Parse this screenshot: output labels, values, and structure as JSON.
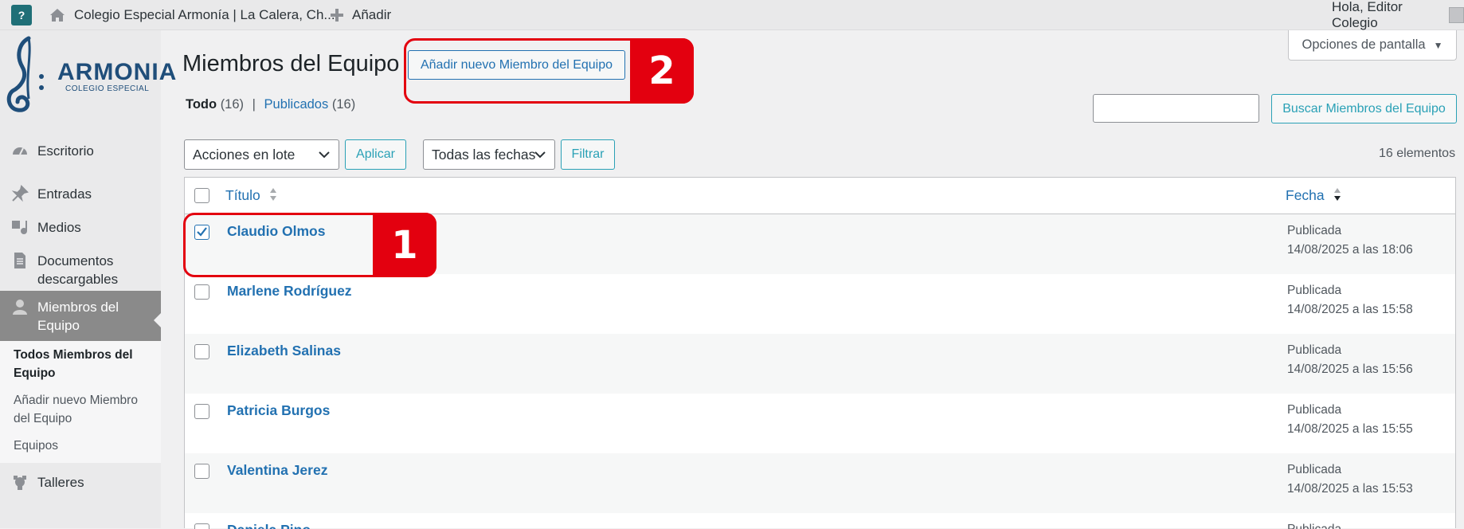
{
  "adminbar": {
    "site_name": "Colegio Especial Armonía | La Calera, Ch...",
    "add_new": "Añadir",
    "greeting": "Hola, Editor Colegio"
  },
  "logo": {
    "name": "ARMONIA",
    "subtitle": "COLEGIO ESPECIAL",
    "color": "#1f4e7a"
  },
  "sidebar": {
    "items": [
      {
        "label": "Escritorio",
        "icon": "dashboard-icon"
      },
      {
        "label": "Entradas",
        "icon": "pin-icon"
      },
      {
        "label": "Medios",
        "icon": "media-icon"
      },
      {
        "label": "Documentos descargables",
        "icon": "document-icon"
      },
      {
        "label": "Miembros del Equipo",
        "icon": "user-icon"
      },
      {
        "label": "Talleres",
        "icon": "plugin-icon"
      }
    ],
    "submenu": [
      {
        "label": "Todos Miembros del Equipo"
      },
      {
        "label": "Añadir nuevo Miembro del Equipo"
      },
      {
        "label": "Equipos"
      }
    ]
  },
  "header": {
    "screen_options": "Opciones de pantalla",
    "title": "Miembros del Equipo",
    "add_new_button": "Añadir nuevo Miembro del Equipo"
  },
  "filters": {
    "all_label": "Todo",
    "all_count": "(16)",
    "separator": "|",
    "published_label": "Publicados",
    "published_count": "(16)",
    "search_value": "",
    "search_button": "Buscar Miembros del Equipo",
    "bulk_actions": "Acciones en lote",
    "apply": "Aplicar",
    "dates": "Todas las fechas",
    "filter": "Filtrar",
    "item_count": "16 elementos"
  },
  "table": {
    "col_title": "Título",
    "col_date": "Fecha",
    "rows": [
      {
        "title": "Claudio Olmos",
        "status": "Publicada",
        "date": "14/08/2025 a las 18:06",
        "checked": true
      },
      {
        "title": "Marlene Rodríguez",
        "status": "Publicada",
        "date": "14/08/2025 a las 15:58",
        "checked": false
      },
      {
        "title": "Elizabeth Salinas",
        "status": "Publicada",
        "date": "14/08/2025 a las 15:56",
        "checked": false
      },
      {
        "title": "Patricia Burgos",
        "status": "Publicada",
        "date": "14/08/2025 a las 15:55",
        "checked": false
      },
      {
        "title": "Valentina Jerez",
        "status": "Publicada",
        "date": "14/08/2025 a las 15:53",
        "checked": false
      },
      {
        "title": "Daniela Pino",
        "status": "Publicada",
        "date": "",
        "checked": false
      }
    ]
  },
  "annotations": {
    "step1": "1",
    "step2": "2",
    "color": "#e3000f"
  }
}
